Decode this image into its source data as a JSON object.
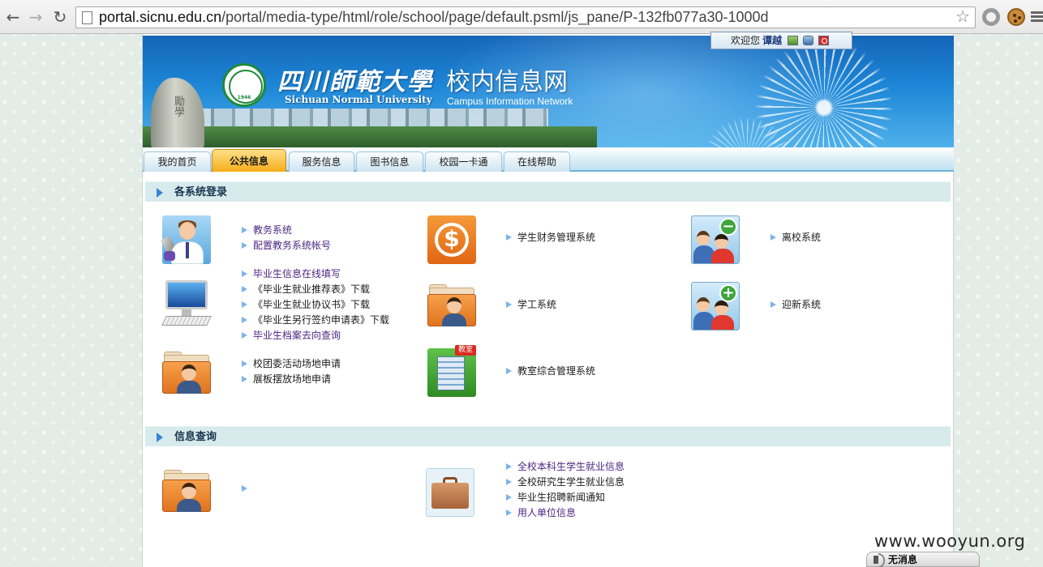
{
  "browser": {
    "url_host": "portal.sicnu.edu.cn",
    "url_path": "/portal/media-type/html/role/school/page/default.psml/js_pane/P-132fb077a30-1000d"
  },
  "banner": {
    "welcome_text": "欢迎您",
    "username": "谭越",
    "school_name_cn": "四川師範大學",
    "school_name_en": "Sichuan Normal University",
    "site_name_cn": "校内信息网",
    "site_name_en": "Campus Information Network",
    "seal_year": "1946"
  },
  "tabs": [
    {
      "label": "我的首页",
      "active": false
    },
    {
      "label": "公共信息",
      "active": true
    },
    {
      "label": "服务信息",
      "active": false
    },
    {
      "label": "图书信息",
      "active": false
    },
    {
      "label": "校园一卡通",
      "active": false
    },
    {
      "label": "在线帮助",
      "active": false
    }
  ],
  "login_section": {
    "title": "各系统登录",
    "groups": [
      {
        "icon": "teacher-icon",
        "links": [
          "教务系统",
          "配置教务系统帐号"
        ]
      },
      {
        "icon": "finance-icon",
        "links": [
          "学生财务管理系统"
        ]
      },
      {
        "icon": "leave-school-icon",
        "links": [
          "离校系统"
        ]
      },
      {
        "icon": "computer-icon",
        "links": [
          "毕业生信息在线填写",
          "《毕业生就业推荐表》下载",
          "《毕业生就业协议书》下载",
          "《毕业生另行签约申请表》下载",
          "毕业生档案去向查询"
        ]
      },
      {
        "icon": "folder-user-icon",
        "links": [
          "学工系统"
        ]
      },
      {
        "icon": "welcome-new-icon",
        "links": [
          "迎新系统"
        ]
      },
      {
        "icon": "folder-user-icon",
        "links": [
          "校团委活动场地申请",
          "展板摆放场地申请"
        ]
      },
      {
        "icon": "classroom-building-icon",
        "badge": "教室",
        "links": [
          "教室综合管理系统"
        ]
      }
    ]
  },
  "info_section": {
    "title": "信息查询",
    "groups": [
      {
        "icon": "folder-user-icon",
        "links": [
          ""
        ]
      },
      {
        "icon": "briefcase-icon",
        "links": [
          "全校本科生学生就业信息",
          "全校研究生学生就业信息",
          "毕业生招聘新闻通知",
          "用人单位信息"
        ]
      }
    ]
  },
  "overlay": {
    "watermark": "www.wooyun.org",
    "notification": "无消息"
  },
  "colors": {
    "active_tab": "#f6ad1a",
    "visited_link": "#4b2682",
    "section_bg": "#d8ebec",
    "banner_blue": "#1d86d6"
  }
}
